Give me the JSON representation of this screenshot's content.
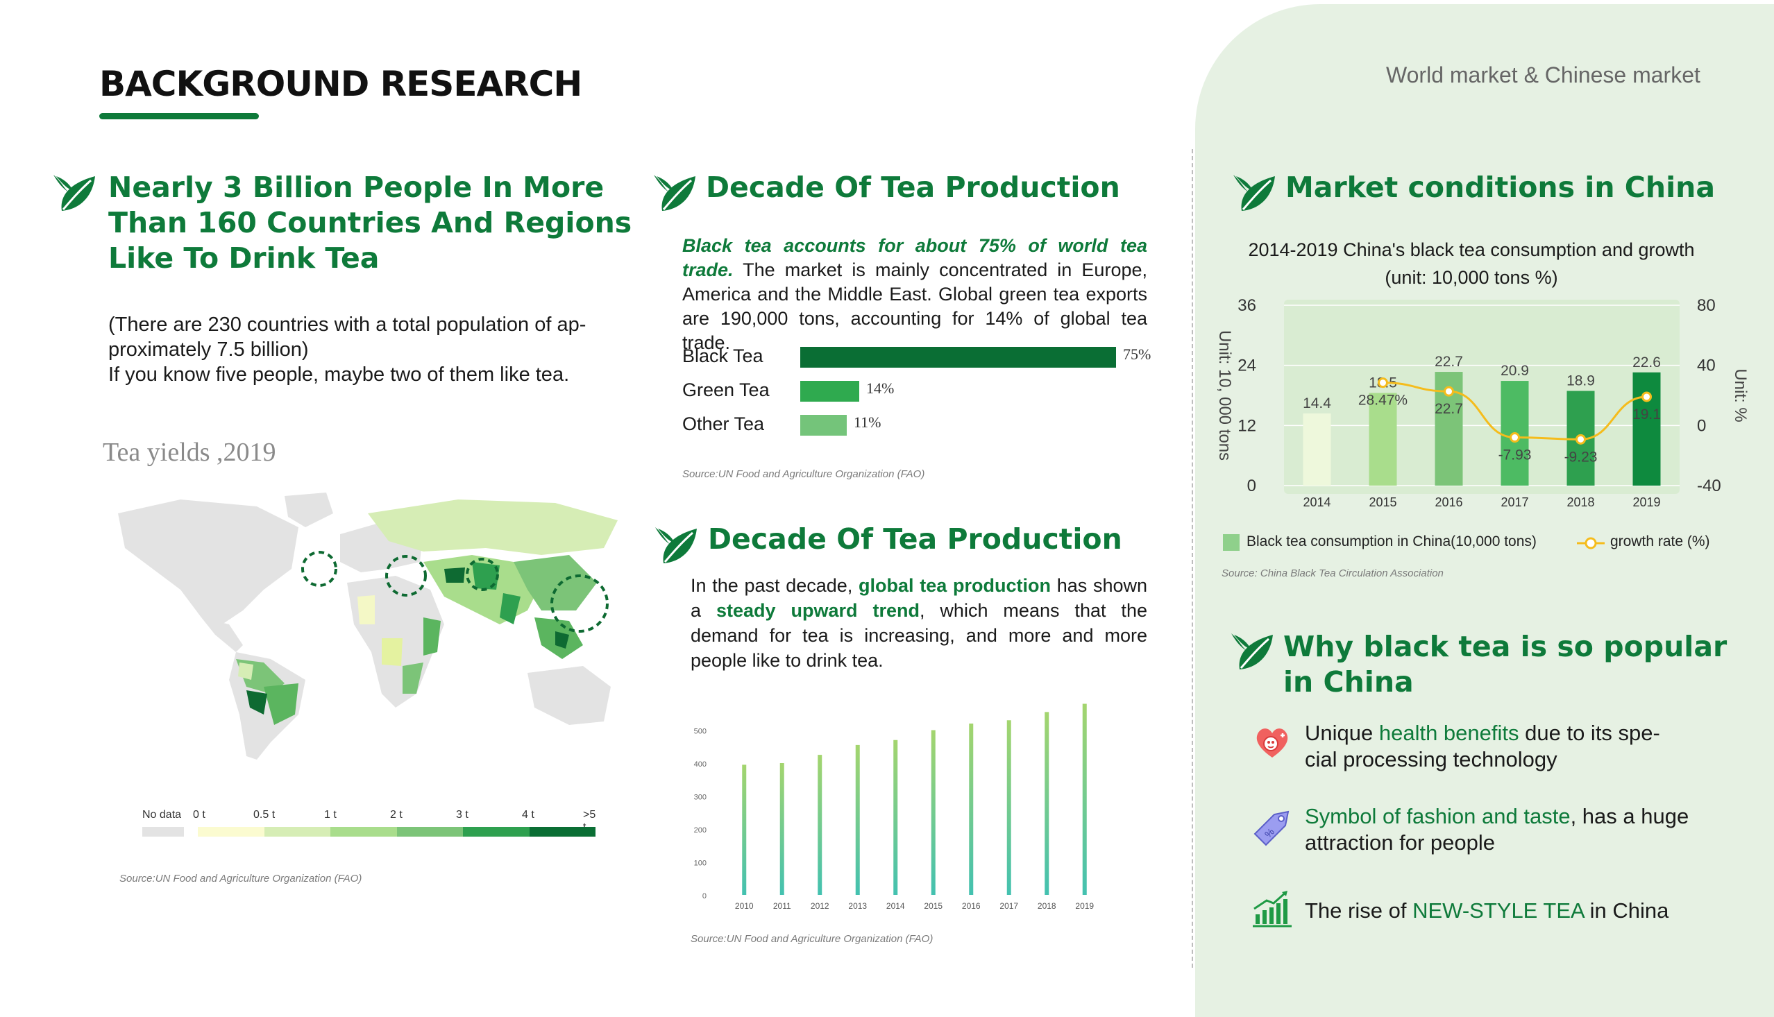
{
  "page": {
    "title": "BACKGROUND RESEARCH",
    "subtitle": "World market & Chinese market"
  },
  "colors": {
    "primary": "#0e7a3a",
    "panel": "#e6f1e3",
    "dark_bar": "#0a6e34"
  },
  "icons": [
    "tea-leaf-icon",
    "heart-health-icon",
    "price-tag-icon",
    "growth-chart-icon"
  ],
  "section1": {
    "title_lines": [
      "Nearly 3 Billion People In More",
      "Than 160 Countries And Regions",
      "Like To Drink Tea"
    ],
    "body_line1": "(There are 230 countries with a total population of ap-",
    "body_line2": "proximately 7.5 billion)",
    "body_line3": "If you know five people, maybe two of them like tea.",
    "map_title": "Tea yields ,2019",
    "legend": [
      "No data",
      "0 t",
      "0.5 t",
      "1 t",
      "2 t",
      "3 t",
      "4 t",
      ">5 t"
    ],
    "source": "Source:UN Food and Agriculture Organization (FAO)"
  },
  "section2": {
    "title": "Decade Of Tea Production",
    "para_hl": "Black tea accounts for about 75% of world tea trade.",
    "para_rest": " The market is mainly concentrated in Europe, America and the Middle East. Global green tea exports are 190,000 tons, accounting for 14% of global tea trade.",
    "source": "Source:UN Food and Agriculture Organization (FAO)"
  },
  "section3": {
    "title": "Decade Of Tea Production",
    "p1": "In the past decade, ",
    "hl1": "global tea production",
    "p2": " has shown a ",
    "hl2": "steady upward trend",
    "p3": ", which means that the demand for tea is increasing, and more and more people like to drink tea.",
    "source": "Source:UN Food and Agriculture Organization (FAO)"
  },
  "section4": {
    "title": "Market conditions in China",
    "source": "Source: China Black Tea Circulation Association"
  },
  "section5": {
    "title_lines": [
      "Why black tea is so popular",
      "in China"
    ],
    "item1_a": "Unique ",
    "item1_hl": "health benefits",
    "item1_b": " due to its spe-",
    "item1_c": "cial processing technology",
    "item2_hl": "Symbol of fashion and taste",
    "item2_b": ", has a huge",
    "item2_c": "attraction for people",
    "item3_a": "The rise of ",
    "item3_hl": "NEW-STYLE TEA",
    "item3_b": " in China"
  },
  "chart_data": [
    {
      "type": "bar",
      "orientation": "horizontal",
      "categories": [
        "Black Tea",
        "Green Tea",
        "Other Tea"
      ],
      "values": [
        75,
        14,
        11
      ],
      "value_labels": [
        "75%",
        "14%",
        "11%"
      ],
      "colors": [
        "#0a6e34",
        "#2faa4f",
        "#74c47a"
      ]
    },
    {
      "type": "bar",
      "categories": [
        "2010",
        "2011",
        "2012",
        "2013",
        "2014",
        "2015",
        "2016",
        "2017",
        "2018",
        "2019"
      ],
      "values": [
        395,
        400,
        425,
        455,
        470,
        500,
        520,
        530,
        555,
        580
      ],
      "yticks": [
        0,
        100,
        200,
        300,
        400,
        500
      ],
      "ylim": [
        0,
        600
      ]
    },
    {
      "type": "bar+line",
      "title": "2014-2019 China's black tea consumption and growth",
      "subtitle": "(unit: 10,000 tons %)",
      "categories": [
        "2014",
        "2015",
        "2016",
        "2017",
        "2018",
        "2019"
      ],
      "ylabel": "Unit:  10,  000 tons",
      "y2label": "Unit: %",
      "ylim": [
        0,
        36
      ],
      "y2lim": [
        -40,
        80
      ],
      "yticks": [
        0,
        12,
        24,
        36
      ],
      "y2ticks": [
        -40,
        0,
        40,
        80
      ],
      "series": [
        {
          "name": "Black tea consumption in China(10,000 tons)",
          "kind": "bar",
          "values": [
            14.4,
            18.5,
            22.7,
            20.9,
            18.9,
            22.6
          ],
          "value_labels": [
            "14.4",
            "18.5",
            "22.7",
            "20.9",
            "18.9",
            "22.6"
          ],
          "colors": [
            "#eef8dc",
            "#a9dd8c",
            "#7cc478",
            "#4dbb63",
            "#2ea04f",
            "#0e8a3e"
          ]
        },
        {
          "name": "growth rate (%)",
          "kind": "line",
          "color": "#f5bc1c",
          "x": [
            "2015",
            "2016",
            "2017",
            "2018",
            "2019"
          ],
          "values": [
            28.47,
            22.7,
            -7.93,
            -9.23,
            19.1
          ],
          "value_labels": [
            "28.47%",
            "22.7",
            "-7.93",
            "-9.23",
            "19.1"
          ]
        }
      ]
    }
  ]
}
